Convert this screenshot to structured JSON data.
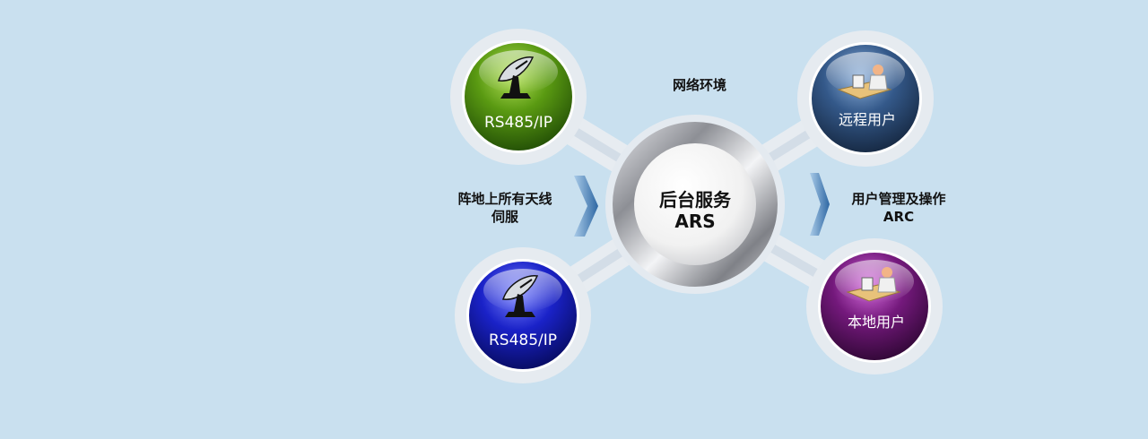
{
  "diagram": {
    "network_label": "网络环境",
    "center": {
      "title": "后台服务",
      "subtitle": "ARS"
    },
    "left_label": {
      "line1": "阵地上所有天线",
      "line2": "伺服"
    },
    "right_label": {
      "line1": "用户管理及操作",
      "line2": "ARC"
    },
    "nodes": {
      "antenna_top": {
        "label": "RS485/IP",
        "color": "#4d8a0c",
        "icon": "satellite-dish-icon"
      },
      "antenna_bottom": {
        "label": "RS485/IP",
        "color": "#1016b8",
        "icon": "satellite-dish-icon"
      },
      "remote_user": {
        "label": "远程用户",
        "color": "#2c4f7c",
        "icon": "user-at-desk-icon"
      },
      "local_user": {
        "label": "本地用户",
        "color": "#6a1a72",
        "icon": "user-at-desk-icon"
      }
    },
    "colors": {
      "background": "#c9e0ef",
      "arrow": "#3f7ab5",
      "center": "#a8a9ad"
    }
  }
}
